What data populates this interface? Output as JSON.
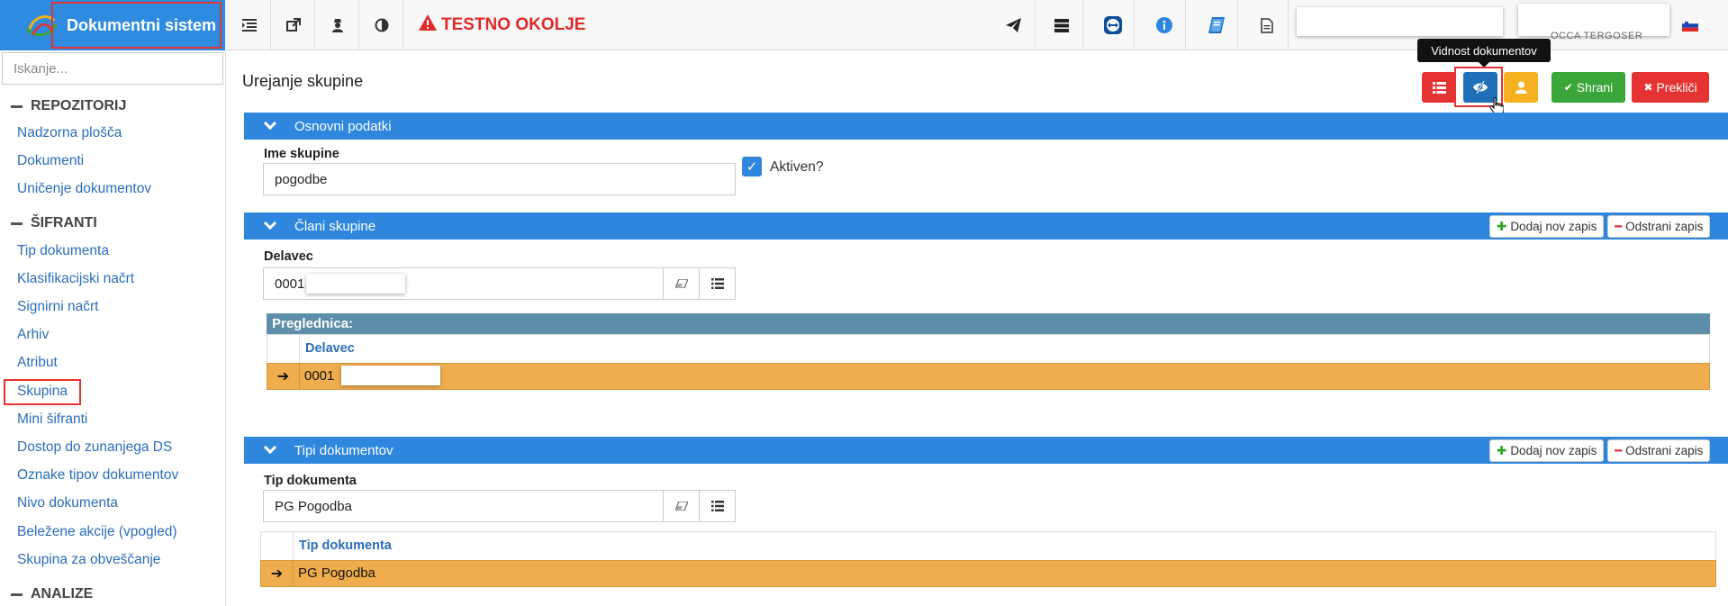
{
  "app": {
    "title": "Dokumentni sistem"
  },
  "topbar": {
    "environment_warning": "TESTNO OKOLJE",
    "icons": [
      "list-indent-icon",
      "external-link-icon",
      "user-secret-icon",
      "contrast-icon",
      "paper-plane-icon",
      "server-icon",
      "teamviewer-icon",
      "info-icon",
      "book-icon",
      "document-icon"
    ],
    "user_fragment": "OCCA TERGOSER",
    "language_flag": "slovenian-flag-icon"
  },
  "sidebar": {
    "search_placeholder": "Iskanje...",
    "sections": [
      {
        "title": "REPOZITORIJ",
        "items": [
          "Nadzorna plošča",
          "Dokumenti",
          "Uničenje dokumentov"
        ]
      },
      {
        "title": "ŠIFRANTI",
        "items": [
          "Tip dokumenta",
          "Klasifikacijski načrt",
          "Signirni načrt",
          "Arhiv",
          "Atribut",
          "Skupina",
          "Mini šifranti",
          "Dostop do zunanjega DS",
          "Oznake tipov dokumentov",
          "Nivo dokumenta",
          "Beležene akcije (vpogled)",
          "Skupina za obveščanje"
        ]
      },
      {
        "title": "ANALIZE",
        "items": []
      }
    ],
    "active_item": "Skupina"
  },
  "main": {
    "title": "Urejanje skupine",
    "tooltip": "Vidnost dokumentov",
    "actions": {
      "save": "Shrani",
      "cancel": "Prekliči"
    },
    "colors": {
      "primary": "#2f86dd",
      "danger": "#e53333",
      "warning": "#f5b120",
      "success": "#3aa63a",
      "row_selected": "#efad4e"
    },
    "panel_basic": {
      "title": "Osnovni podatki",
      "name_label": "Ime skupine",
      "name_value": "pogodbe",
      "active_label": "Aktiven?",
      "active_checked": true
    },
    "panel_members": {
      "title": "Člani skupine",
      "add_label": "Dodaj nov zapis",
      "remove_label": "Odstrani zapis",
      "field_label": "Delavec",
      "field_value": "0001",
      "grid_caption": "Preglednica:",
      "grid_header": "Delavec",
      "rows": [
        "0001"
      ]
    },
    "panel_types": {
      "title": "Tipi dokumentov",
      "add_label": "Dodaj nov zapis",
      "remove_label": "Odstrani zapis",
      "field_label": "Tip dokumenta",
      "field_value": "PG Pogodba",
      "grid_header": "Tip dokumenta",
      "rows": [
        "PG Pogodba"
      ]
    }
  }
}
